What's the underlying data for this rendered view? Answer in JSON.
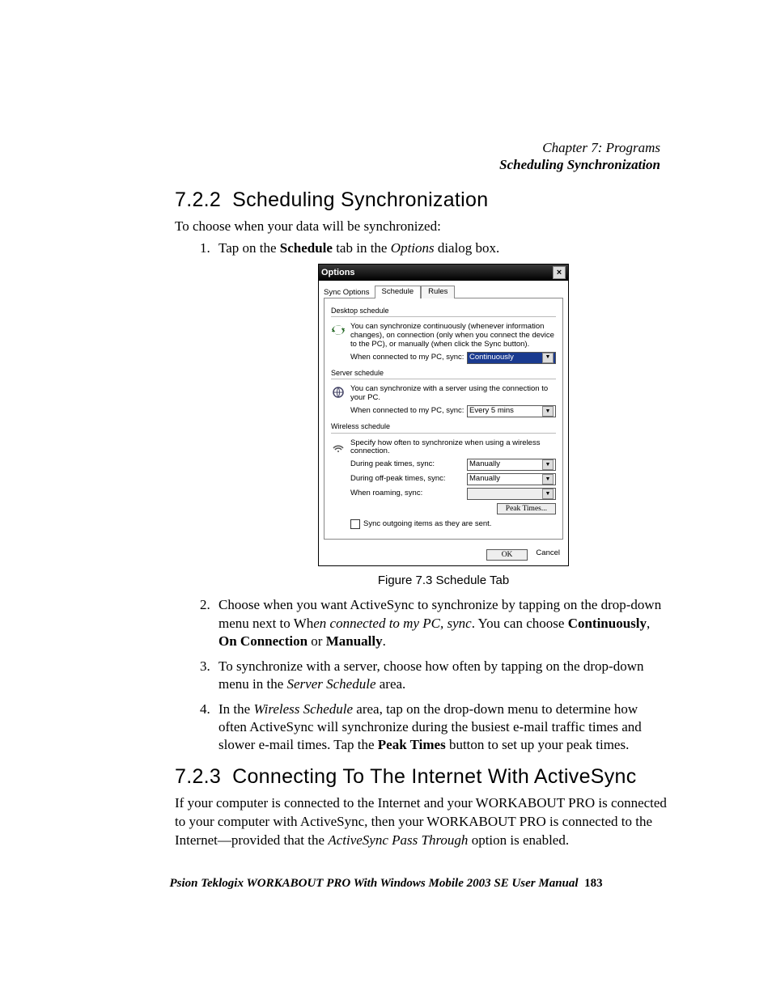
{
  "header": {
    "chapter": "Chapter 7: Programs",
    "section": "Scheduling Synchronization"
  },
  "s1": {
    "num": "7.2.2",
    "title": "Scheduling Synchronization",
    "intro": "To choose when your data will be synchronized:",
    "step1_a": "Tap on the ",
    "step1_b": "Schedule",
    "step1_c": " tab in the ",
    "step1_d": "Options",
    "step1_e": " dialog box.",
    "figcap": "Figure 7.3 Schedule Tab",
    "step2_a": "Choose when you want ActiveSync to synchronize by tapping on the drop-down menu next to Wh",
    "step2_b": "en connected to my PC, sync",
    "step2_c": ". You can choose ",
    "step2_d": "Continuously",
    "step2_e": ", ",
    "step2_f": "On Connection",
    "step2_g": " or ",
    "step2_h": "Manually",
    "step2_i": ".",
    "step3_a": "To synchronize with a server, choose how often by tapping on the drop-down menu in the ",
    "step3_b": "Server Schedule",
    "step3_c": " area.",
    "step4_a": "In the ",
    "step4_b": "Wireless Schedule",
    "step4_c": " area, tap on the drop-down menu to determine how often ActiveSync will synchronize during the busiest e-mail traffic times and slower e-mail times. Tap the ",
    "step4_d": "Peak Times",
    "step4_e": " button to set up your peak times."
  },
  "s2": {
    "num": "7.2.3",
    "title": "Connecting To The Internet With ActiveSync",
    "p_a": "If your computer is connected to the Internet and your WORKABOUT PRO is connected to your computer with ActiveSync, then your WORKABOUT PRO is connected to the Internet—provided that the ",
    "p_b": "ActiveSync Pass Through",
    "p_c": " option is enabled."
  },
  "mock": {
    "title": "Options",
    "tablabel": "Sync Options",
    "tab_schedule": "Schedule",
    "tab_rules": "Rules",
    "g_desktop": "Desktop schedule",
    "desktop_txt": "You can synchronize continuously (whenever information changes), on connection (only when you connect the device to the PC), or manually (when click the Sync button).",
    "lbl_pc": "When connected to my PC, sync:",
    "val_pc": "Continuously",
    "g_server": "Server schedule",
    "server_txt": "You can synchronize with a server using the connection to your PC.",
    "lbl_srv": "When connected to my PC, sync:",
    "val_srv": "Every 5 mins",
    "g_wireless": "Wireless schedule",
    "wireless_txt": "Specify how often to synchronize when using a wireless connection.",
    "lbl_peak": "During peak times, sync:",
    "val_peak": "Manually",
    "lbl_off": "During off-peak times, sync:",
    "val_off": "Manually",
    "lbl_roam": "When roaming, sync:",
    "val_roam": "",
    "btn_peaktimes": "Peak Times...",
    "chk": "Sync outgoing items as they are sent.",
    "ok": "OK",
    "cancel": "Cancel"
  },
  "footer": {
    "a": "Psion Teklogix WORKABOUT PRO With Windows Mobile 2003 SE User Manual",
    "pg": "183"
  }
}
